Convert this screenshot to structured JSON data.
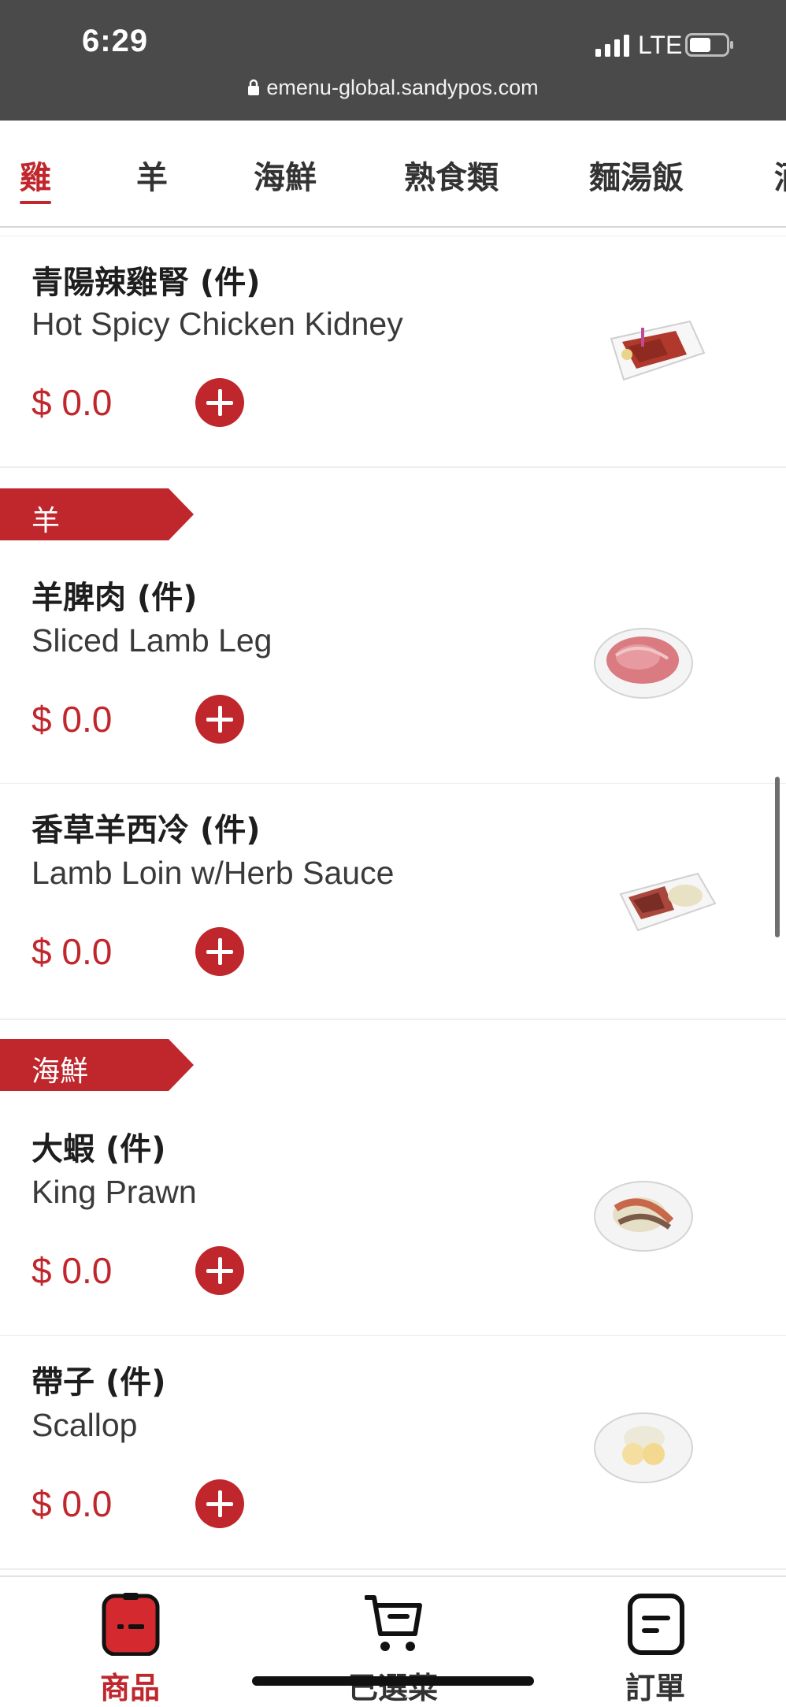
{
  "status_bar": {
    "time": "6:29",
    "network": "LTE",
    "url": "emenu-global.sandypos.com"
  },
  "tabs": [
    {
      "label": "雞"
    },
    {
      "label": "羊"
    },
    {
      "label": "海鮮"
    },
    {
      "label": "熟食類"
    },
    {
      "label": "麵湯飯"
    },
    {
      "label": "酒"
    }
  ],
  "active_tab": "雞",
  "sections": [
    {
      "title": "羊"
    },
    {
      "title": "海鮮"
    }
  ],
  "items": [
    {
      "name_zh": "青陽辣雞腎 (件)",
      "name_en": "Hot Spicy Chicken Kidney",
      "price": "$ 0.0"
    },
    {
      "name_zh": "羊脾肉 (件)",
      "name_en": "Sliced Lamb Leg",
      "price": "$ 0.0"
    },
    {
      "name_zh": "香草羊西冷 (件)",
      "name_en": "Lamb Loin w/Herb Sauce",
      "price": "$ 0.0"
    },
    {
      "name_zh": "大蝦 (件)",
      "name_en": "King Prawn",
      "price": "$ 0.0"
    },
    {
      "name_zh": "帶子 (件)",
      "name_en": "Scallop",
      "price": "$ 0.0"
    }
  ],
  "bottom_nav": [
    {
      "label": "商品",
      "icon": "products-icon"
    },
    {
      "label": "已選菜",
      "icon": "cart-icon"
    },
    {
      "label": "訂單",
      "icon": "orders-icon"
    }
  ],
  "colors": {
    "accent": "#c0272d",
    "status_bar": "#4a4a4a",
    "text": "#1e1e1e"
  }
}
